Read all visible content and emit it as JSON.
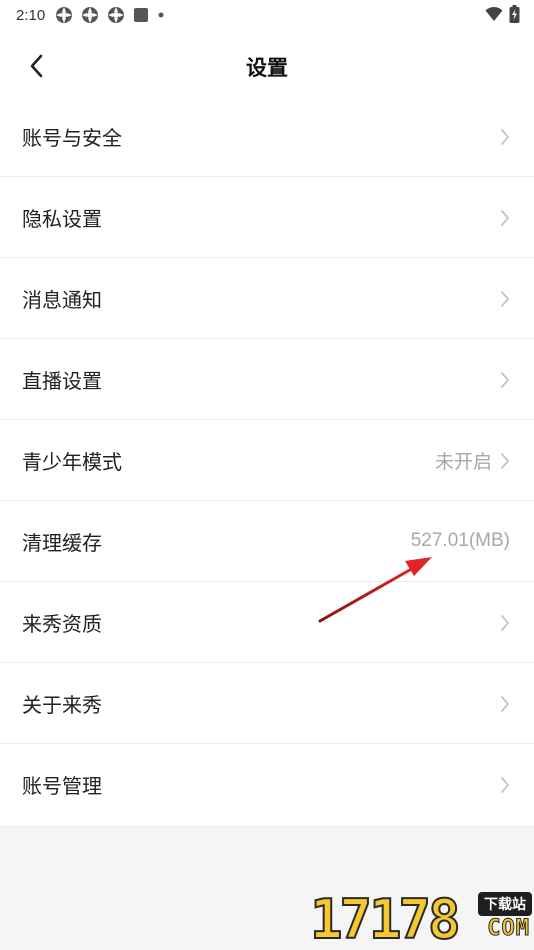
{
  "status_bar": {
    "time": "2:10",
    "left_icons": [
      "app-notification-icon",
      "app-notification-icon",
      "app-notification-icon",
      "stop-square-icon",
      "dot-icon"
    ],
    "right_icons": [
      "wifi-icon",
      "battery-charging-icon"
    ]
  },
  "header": {
    "title": "设置",
    "back_icon": "chevron-left-icon"
  },
  "settings": {
    "items": [
      {
        "label": "账号与安全",
        "value": ""
      },
      {
        "label": "隐私设置",
        "value": ""
      },
      {
        "label": "消息通知",
        "value": ""
      },
      {
        "label": "直播设置",
        "value": ""
      },
      {
        "label": "青少年模式",
        "value": "未开启"
      },
      {
        "label": "清理缓存",
        "value": "527.01(MB)"
      },
      {
        "label": "来秀资质",
        "value": ""
      },
      {
        "label": "关于来秀",
        "value": ""
      },
      {
        "label": "账号管理",
        "value": ""
      }
    ]
  },
  "annotation": {
    "arrow_color": "#d62020"
  },
  "watermark": {
    "logo_digits": "17178",
    "badge": "下载站",
    "suffix": "COM"
  },
  "colors": {
    "background": "#f5f5f5",
    "row_bg": "#ffffff",
    "value_text": "#a8a8a8",
    "chevron": "#c4c4c4"
  }
}
